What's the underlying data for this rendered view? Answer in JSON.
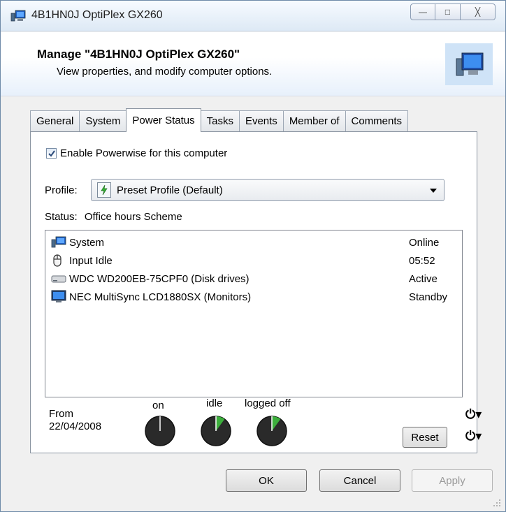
{
  "window": {
    "title": "4B1HN0J OptiPlex GX260",
    "minimize_label": "—",
    "maximize_label": "□",
    "close_label": "╳"
  },
  "header": {
    "title": "Manage \"4B1HN0J OptiPlex GX260\"",
    "subtitle": "View properties, and modify computer options.",
    "icon": "computer-icon"
  },
  "tabs": [
    {
      "label": "General"
    },
    {
      "label": "System"
    },
    {
      "label": "Power Status",
      "active": true
    },
    {
      "label": "Tasks"
    },
    {
      "label": "Events"
    },
    {
      "label": "Member of"
    },
    {
      "label": "Comments"
    }
  ],
  "power": {
    "enable_checkbox_label": "Enable Powerwise for this computer",
    "enable_checked": true,
    "profile_label": "Profile:",
    "profile_value": "Preset Profile (Default)",
    "status_label": "Status:",
    "status_value": "Office hours Scheme",
    "devices": [
      {
        "name": "System",
        "state": "Online",
        "icon": "computer-icon"
      },
      {
        "name": "Input Idle",
        "state": "05:52",
        "icon": "mouse-icon"
      },
      {
        "name": "WDC WD200EB-75CPF0 (Disk drives)",
        "state": "Active",
        "icon": "disk-drive-icon"
      },
      {
        "name": "NEC MultiSync LCD1880SX (Monitors)",
        "state": "Standby",
        "icon": "monitor-icon"
      }
    ],
    "from_label": "From",
    "from_date": "22/04/2008",
    "gauges": [
      {
        "label": "on",
        "green_fraction": 0.0
      },
      {
        "label": "idle",
        "green_fraction": 0.1
      },
      {
        "label": "logged off",
        "green_fraction": 0.1
      }
    ],
    "reset_label": "Reset",
    "power_menu_1": "⏻▾",
    "power_menu_2": "⏻▾"
  },
  "buttons": {
    "ok": "OK",
    "cancel": "Cancel",
    "apply": "Apply"
  },
  "colors": {
    "gauge_fill": "#2a2a2a",
    "gauge_accent": "#3cae3c",
    "header_icon_bg": "#cfe3f7"
  }
}
